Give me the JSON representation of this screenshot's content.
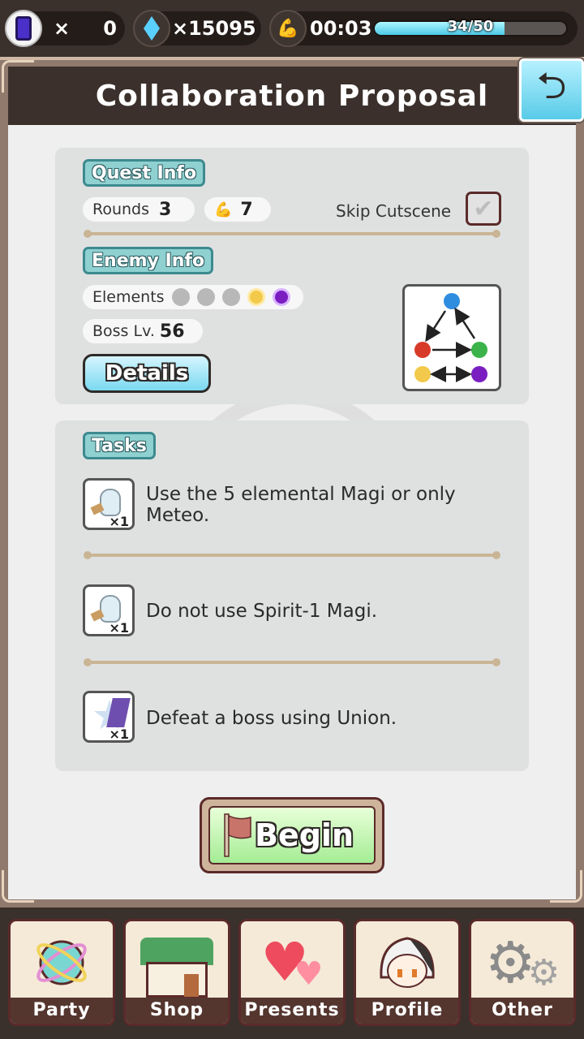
{
  "status_bar": {
    "magi_x": "×",
    "magi_count": "0",
    "gems": "×15095",
    "stamina_timer": "00:03",
    "stamina_text": "34/50",
    "stamina_fraction": 0.68
  },
  "header": {
    "title": "Collaboration Proposal"
  },
  "quest_info": {
    "tag": "Quest Info",
    "rounds_label": "Rounds",
    "rounds_value": "3",
    "stamina_cost": "7",
    "skip_label": "Skip Cutscene",
    "skip_checked": "✔"
  },
  "enemy_info": {
    "tag": "Enemy Info",
    "elements_label": "Elements",
    "boss_label": "Boss Lv.",
    "boss_level": "56",
    "details_button": "Details"
  },
  "tasks": {
    "tag": "Tasks",
    "items": [
      {
        "text": "Use the 5 elemental Magi or only Meteo.",
        "qty": "×1"
      },
      {
        "text": "Do not use Spirit-1 Magi.",
        "qty": "×1"
      },
      {
        "text": "Defeat a boss using Union.",
        "qty": "×1"
      }
    ]
  },
  "begin_button": "Begin",
  "nav": {
    "party": "Party",
    "shop": "Shop",
    "presents": "Presents",
    "profile": "Profile",
    "other": "Other"
  },
  "colors": {
    "accent_teal": "#8fd0d0",
    "frame_dark": "#3b302b",
    "begin_green": "#a5ec95"
  }
}
